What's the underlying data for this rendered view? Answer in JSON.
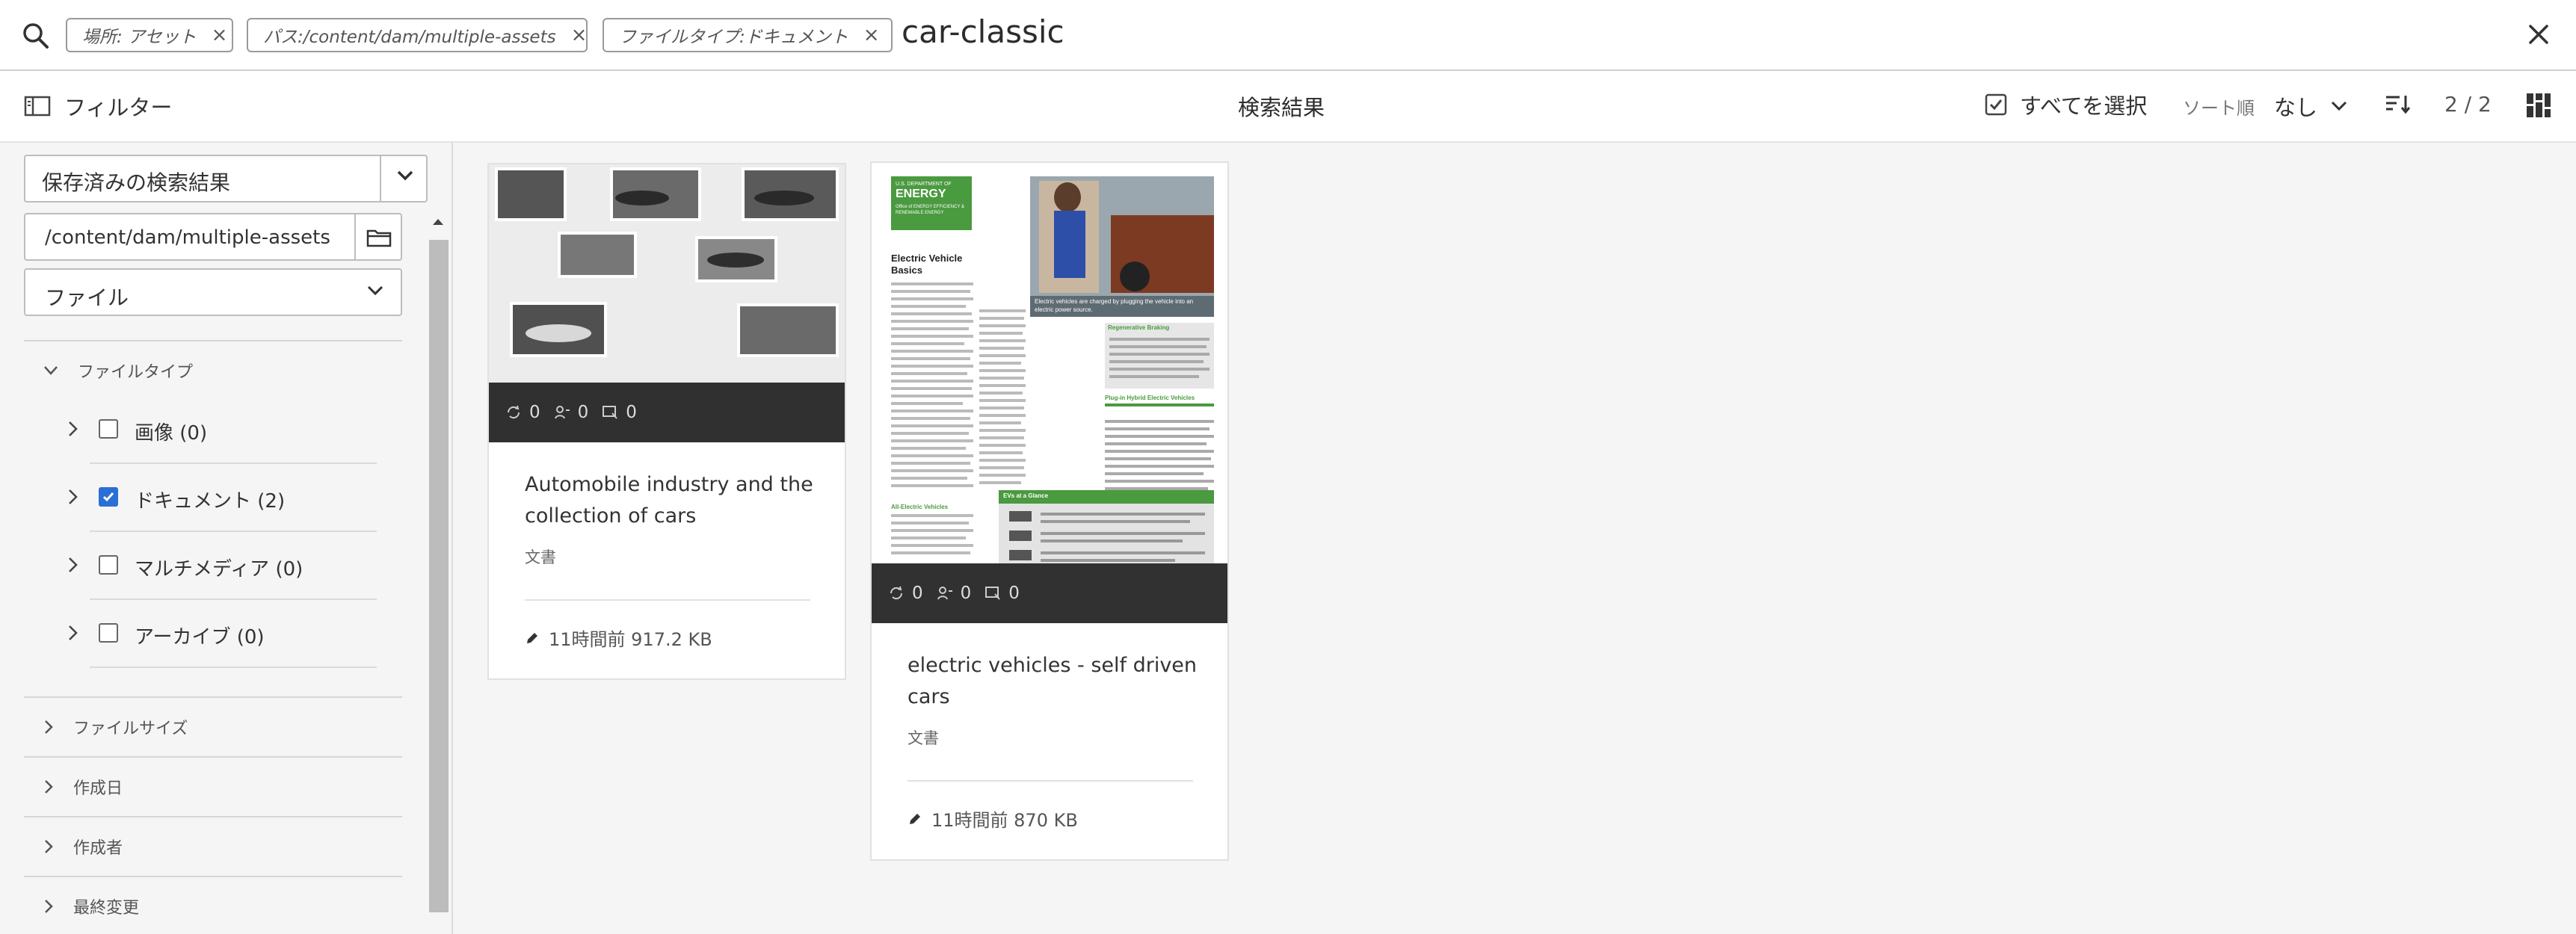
{
  "search": {
    "tags": [
      {
        "label": "場所: アセット"
      },
      {
        "label": "パス:/content/dam/multiple-assets"
      },
      {
        "label": "ファイルタイプ:ドキュメント"
      }
    ],
    "query": "car-classic",
    "tag_remove_symbol": "×",
    "close_symbol": "✕"
  },
  "toolbar": {
    "filter_label": "フィルター",
    "title": "検索結果",
    "select_all_label": "すべてを選択",
    "sort_label": "ソート順",
    "sort_value": "なし",
    "count": "2 / 2"
  },
  "rail": {
    "saved_search": "保存済みの検索結果",
    "path_value": "/content/dam/multiple-assets",
    "type_select": "ファイル",
    "sections": [
      {
        "label": "ファイルタイプ",
        "expanded": true
      },
      {
        "label": "ファイルサイズ",
        "expanded": false
      },
      {
        "label": "作成日",
        "expanded": false
      },
      {
        "label": "作成者",
        "expanded": false
      },
      {
        "label": "最終変更",
        "expanded": false
      }
    ],
    "file_types": [
      {
        "label": "画像 (0)",
        "checked": false
      },
      {
        "label": "ドキュメント (2)",
        "checked": true
      },
      {
        "label": "マルチメディア (0)",
        "checked": false
      },
      {
        "label": "アーカイブ (0)",
        "checked": false
      }
    ]
  },
  "cards": [
    {
      "title": "Automobile industry and the collection of cars",
      "type": "文書",
      "meta": "11時間前  917.2 KB",
      "stats": {
        "versions": "0",
        "references": "0",
        "comments": "0"
      }
    },
    {
      "title": "electric vehicles - self driven cars",
      "type": "文書",
      "meta": "11時間前  870 KB",
      "stats": {
        "versions": "0",
        "references": "0",
        "comments": "0"
      },
      "thumb": {
        "badge_line1": "U.S. DEPARTMENT OF",
        "badge_line2": "ENERGY",
        "badge_line3": "Office of ENERGY EFFICIENCY & RENEWABLE ENERGY",
        "heading": "Electric Vehicle Basics",
        "caption": "Electric vehicles are charged by plugging the vehicle into an electric power source.",
        "section1": "Regenerative Braking",
        "section2": "Plug-in Hybrid Electric Vehicles",
        "section3": "EVs at a Glance",
        "section4": "All-Electric Vehicles"
      }
    }
  ],
  "colors": {
    "accent": "#2b6fd6",
    "energy_green": "#4a9a3f",
    "statbar": "#1e1e1e"
  }
}
